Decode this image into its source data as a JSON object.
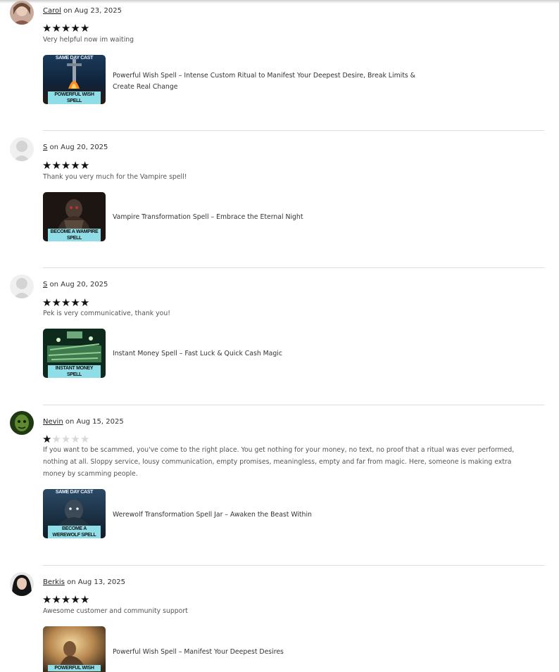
{
  "reviews": [
    {
      "name": "Carol",
      "date_text": " on Aug 23, 2025",
      "rating": 5,
      "text": "Very helpful now im waiting",
      "product": {
        "title": "Powerful Wish Spell – Intense Custom Ritual to Manifest Your Deepest Desire, Break Limits & Create Real Change",
        "thumb_top_text": "SAME DAY CAST",
        "thumb_label": "POWERFUL WISH SPELL"
      }
    },
    {
      "name": "S",
      "date_text": " on Aug 20, 2025",
      "rating": 5,
      "text": "Thank you very much for the Vampire spell!",
      "product": {
        "title": "Vampire Transformation Spell – Embrace the Eternal Night",
        "thumb_top_text": "",
        "thumb_label": "BECOME A WAMPIRE SPELL"
      }
    },
    {
      "name": "S",
      "date_text": " on Aug 20, 2025",
      "rating": 5,
      "text": "Pek is very communicative, thank you!",
      "product": {
        "title": "Instant Money Spell – Fast Luck & Quick Cash Magic",
        "thumb_top_text": "",
        "thumb_label": "INSTANT MONEY SPELL"
      }
    },
    {
      "name": "Nevin",
      "date_text": " on Aug 15, 2025",
      "rating": 1,
      "text": "If you want to be scammed, you've come to the right place. You get nothing for your money, no text, no proof that a ritual was ever performed, nothing at all. Sloppy service, lousy communication, empty promises, meaningless, empty and far from magic. Here, someone is making extra money by scamming people.",
      "product": {
        "title": "Werewolf Transformation Spell Jar – Awaken the Beast Within",
        "thumb_top_text": "SAME DAY CAST",
        "thumb_label": "BECOME A WEREWOLF SPELL"
      }
    },
    {
      "name": "Berkis",
      "date_text": " on Aug 13, 2025",
      "rating": 5,
      "text": "Awesome customer and community support",
      "product": {
        "title": "Powerful Wish Spell – Manifest Your Deepest Desires",
        "thumb_top_text": "",
        "thumb_label": "POWERFUL WISH"
      }
    }
  ],
  "icons": {
    "star": "filled-star-icon",
    "avatar_default": "default-user-avatar-icon"
  },
  "colors": {
    "star_filled": "#111111",
    "star_empty": "#d8d8d8",
    "divider": "#dddddd",
    "thumb_label_bg": "#8fdde6"
  }
}
